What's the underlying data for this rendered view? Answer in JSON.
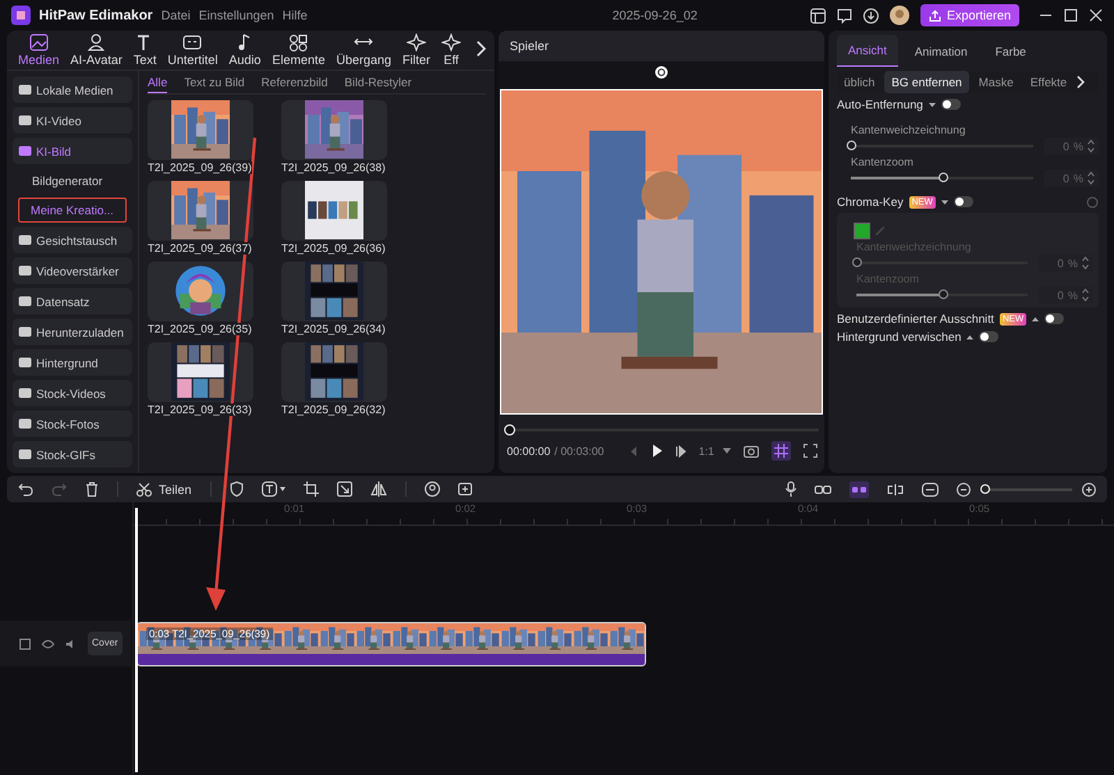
{
  "app": {
    "title": "HitPaw Edimakor",
    "menu": [
      "Datei",
      "Einstellungen",
      "Hilfe"
    ],
    "project": "2025-09-26_02",
    "export": "Exportieren"
  },
  "toolbar": [
    {
      "label": "Medien",
      "selected": true
    },
    {
      "label": "AI-Avatar",
      "selected": false
    },
    {
      "label": "Text",
      "selected": false
    },
    {
      "label": "Untertitel",
      "selected": false
    },
    {
      "label": "Audio",
      "selected": false
    },
    {
      "label": "Elemente",
      "selected": false
    },
    {
      "label": "Übergang",
      "selected": false
    },
    {
      "label": "Filter",
      "selected": false
    },
    {
      "label": "Eff",
      "selected": false
    }
  ],
  "sidebar": [
    {
      "label": "Lokale Medien",
      "selected": false
    },
    {
      "label": "KI-Video",
      "selected": false
    },
    {
      "label": "KI-Bild",
      "selected": true,
      "children": [
        {
          "label": "Bildgenerator",
          "selected": false
        },
        {
          "label": "Meine Kreatio...",
          "selected": true
        }
      ]
    },
    {
      "label": "Gesichtstausch",
      "selected": false
    },
    {
      "label": "Videoverstärker",
      "selected": false
    },
    {
      "label": "Datensatz",
      "selected": false
    },
    {
      "label": "Herunterzuladen",
      "selected": false
    },
    {
      "label": "Hintergrund",
      "selected": false
    },
    {
      "label": "Stock-Videos",
      "selected": false
    },
    {
      "label": "Stock-Fotos",
      "selected": false
    },
    {
      "label": "Stock-GIFs",
      "selected": false
    }
  ],
  "media_tabs": [
    {
      "label": "Alle",
      "selected": true
    },
    {
      "label": "Text zu Bild",
      "selected": false
    },
    {
      "label": "Referenzbild",
      "selected": false
    },
    {
      "label": "Bild-Restyler",
      "selected": false
    }
  ],
  "media": [
    {
      "label": "T2I_2025_09_26(39)"
    },
    {
      "label": "T2I_2025_09_26(38)"
    },
    {
      "label": "T2I_2025_09_26(37)"
    },
    {
      "label": "T2I_2025_09_26(36)"
    },
    {
      "label": "T2I_2025_09_26(35)"
    },
    {
      "label": "T2I_2025_09_26(34)"
    },
    {
      "label": "T2I_2025_09_26(33)"
    },
    {
      "label": "T2I_2025_09_26(32)"
    }
  ],
  "player": {
    "title": "Spieler",
    "progress": {
      "level": 0
    },
    "time": "00:00:00",
    "duration": "/ 00:03:00",
    "ratio": "1:1"
  },
  "inspector": {
    "tabs": [
      {
        "label": "Ansicht",
        "selected": true
      },
      {
        "label": "Animation",
        "selected": false
      },
      {
        "label": "Farbe",
        "selected": false
      }
    ],
    "subtabs": [
      {
        "label": "üblich",
        "selected": false
      },
      {
        "label": "BG entfernen",
        "selected": true
      },
      {
        "label": "Maske",
        "selected": false
      },
      {
        "label": "Effekte",
        "selected": false
      }
    ],
    "auto_removal": {
      "label": "Auto-Entfernung",
      "on": false
    },
    "sliders": [
      {
        "label": "Kantenweichzeichnung",
        "level": 0,
        "value": "0",
        "unit": "%"
      },
      {
        "label": "Kantenzoom",
        "level": 0.5,
        "value": "0",
        "unit": "%"
      }
    ],
    "chroma": {
      "label": "Chroma-Key",
      "badge": "NEW",
      "on": false,
      "color": "#22a82a",
      "sliders": [
        {
          "label": "Kantenweichzeichnung",
          "level": 0,
          "value": "0",
          "unit": "%"
        },
        {
          "label": "Kantenzoom",
          "level": 0.5,
          "value": "0",
          "unit": "%"
        }
      ]
    },
    "custom_cut": {
      "label": "Benutzerdefinierter Ausschnitt",
      "badge": "NEW",
      "on": false
    },
    "blur": {
      "label": "Hintergrund verwischen",
      "on": false
    }
  },
  "timeline": {
    "split": "Teilen",
    "ruler": [
      "0:01",
      "0:02",
      "0:03",
      "0:04",
      "0:05"
    ],
    "zoom": {
      "level": 0.04
    },
    "cover": "Cover",
    "clip": {
      "duration": "0:03",
      "label": "T2I_2025_09_26(39)"
    }
  }
}
